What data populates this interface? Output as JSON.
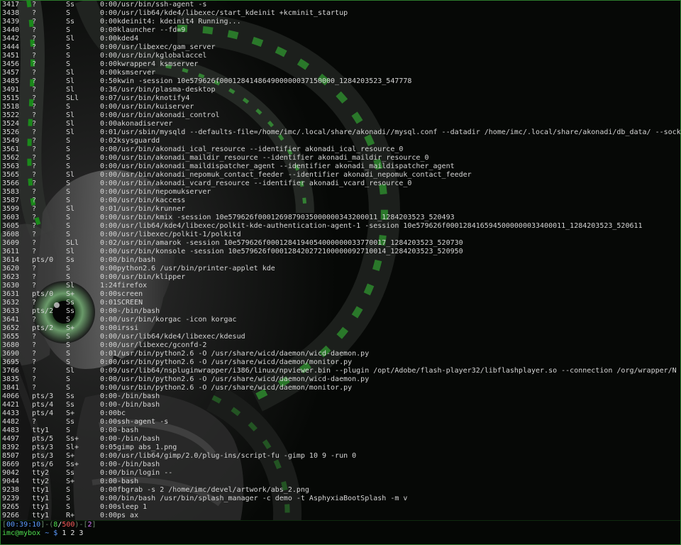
{
  "processes": [
    {
      "pid": "3417",
      "tty": "?",
      "stat": "Ss",
      "time": "0:00",
      "command": "/usr/bin/ssh-agent -s"
    },
    {
      "pid": "3438",
      "tty": "?",
      "stat": "S",
      "time": "0:00",
      "command": "/usr/lib64/kde4/libexec/start_kdeinit +kcminit_startup"
    },
    {
      "pid": "3439",
      "tty": "?",
      "stat": "Ss",
      "time": "0:00",
      "command": "kdeinit4: kdeinit4 Running..."
    },
    {
      "pid": "3440",
      "tty": "?",
      "stat": "S",
      "time": "0:00",
      "command": "klauncher --fd=9"
    },
    {
      "pid": "3442",
      "tty": "?",
      "stat": "Sl",
      "time": "0:00",
      "command": "kded4"
    },
    {
      "pid": "3444",
      "tty": "?",
      "stat": "S",
      "time": "0:00",
      "command": "/usr/libexec/gam_server"
    },
    {
      "pid": "3451",
      "tty": "?",
      "stat": "S",
      "time": "0:00",
      "command": "/usr/bin/kglobalaccel"
    },
    {
      "pid": "3456",
      "tty": "?",
      "stat": "S",
      "time": "0:00",
      "command": "kwrapper4 ksmserver"
    },
    {
      "pid": "3457",
      "tty": "?",
      "stat": "Sl",
      "time": "0:00",
      "command": "ksmserver"
    },
    {
      "pid": "3485",
      "tty": "?",
      "stat": "Sl",
      "time": "0:50",
      "command": "kwin -session 10e579626f000128414864900000037150000_1284203523_547778"
    },
    {
      "pid": "3491",
      "tty": "?",
      "stat": "Sl",
      "time": "0:36",
      "command": "/usr/bin/plasma-desktop"
    },
    {
      "pid": "3515",
      "tty": "?",
      "stat": "SLl",
      "time": "0:07",
      "command": "/usr/bin/knotify4"
    },
    {
      "pid": "3518",
      "tty": "?",
      "stat": "S",
      "time": "0:00",
      "command": "/usr/bin/kuiserver"
    },
    {
      "pid": "3522",
      "tty": "?",
      "stat": "Sl",
      "time": "0:00",
      "command": "/usr/bin/akonadi_control"
    },
    {
      "pid": "3524",
      "tty": "?",
      "stat": "Sl",
      "time": "0:00",
      "command": "akonadiserver"
    },
    {
      "pid": "3526",
      "tty": "?",
      "stat": "Sl",
      "time": "0:01",
      "command": "/usr/sbin/mysqld --defaults-file=/home/imc/.local/share/akonadi//mysql.conf --datadir /home/imc/.local/share/akonadi/db_data/ --sock"
    },
    {
      "pid": "3549",
      "tty": "?",
      "stat": "S",
      "time": "0:02",
      "command": "ksysguardd"
    },
    {
      "pid": "3561",
      "tty": "?",
      "stat": "S",
      "time": "0:00",
      "command": "/usr/bin/akonadi_ical_resource --identifier akonadi_ical_resource_0"
    },
    {
      "pid": "3562",
      "tty": "?",
      "stat": "S",
      "time": "0:00",
      "command": "/usr/bin/akonadi_maildir_resource --identifier akonadi_maildir_resource_0"
    },
    {
      "pid": "3563",
      "tty": "?",
      "stat": "S",
      "time": "0:00",
      "command": "/usr/bin/akonadi_maildispatcher_agent --identifier akonadi_maildispatcher_agent"
    },
    {
      "pid": "3565",
      "tty": "?",
      "stat": "Sl",
      "time": "0:00",
      "command": "/usr/bin/akonadi_nepomuk_contact_feeder --identifier akonadi_nepomuk_contact_feeder"
    },
    {
      "pid": "3566",
      "tty": "?",
      "stat": "S",
      "time": "0:00",
      "command": "/usr/bin/akonadi_vcard_resource --identifier akonadi_vcard_resource_0"
    },
    {
      "pid": "3583",
      "tty": "?",
      "stat": "S",
      "time": "0:00",
      "command": "/usr/bin/nepomukserver"
    },
    {
      "pid": "3587",
      "tty": "?",
      "stat": "S",
      "time": "0:00",
      "command": "/usr/bin/kaccess"
    },
    {
      "pid": "3599",
      "tty": "?",
      "stat": "Sl",
      "time": "0:01",
      "command": "/usr/bin/krunner"
    },
    {
      "pid": "3603",
      "tty": "?",
      "stat": "S",
      "time": "0:00",
      "command": "/usr/bin/kmix -session 10e579626f0001269879035000000343200011_1284203523_520493"
    },
    {
      "pid": "3605",
      "tty": "?",
      "stat": "S",
      "time": "0:00",
      "command": "/usr/lib64/kde4/libexec/polkit-kde-authentication-agent-1 -session 10e579626f0001284165945000000033400011_1284203523_520611"
    },
    {
      "pid": "3608",
      "tty": "?",
      "stat": "S",
      "time": "0:00",
      "command": "/usr/libexec/polkit-1/polkitd"
    },
    {
      "pid": "3609",
      "tty": "?",
      "stat": "SLl",
      "time": "0:02",
      "command": "/usr/bin/amarok -session 10e579626f0001284194054000000033770017_1284203523_520730"
    },
    {
      "pid": "3611",
      "tty": "?",
      "stat": "Sl",
      "time": "0:00",
      "command": "/usr/bin/konsole -session 10e579626f000128420272100000092710014_1284203523_520950"
    },
    {
      "pid": "3614",
      "tty": "pts/0",
      "stat": "Ss",
      "time": "0:00",
      "command": "/bin/bash"
    },
    {
      "pid": "3620",
      "tty": "?",
      "stat": "S",
      "time": "0:00",
      "command": "python2.6 /usr/bin/printer-applet kde"
    },
    {
      "pid": "3623",
      "tty": "?",
      "stat": "S",
      "time": "0:00",
      "command": "/usr/bin/klipper"
    },
    {
      "pid": "3630",
      "tty": "?",
      "stat": "Sl",
      "time": "1:24",
      "command": "firefox"
    },
    {
      "pid": "3631",
      "tty": "pts/0",
      "stat": "S+",
      "time": "0:00",
      "command": "screen"
    },
    {
      "pid": "3632",
      "tty": "?",
      "stat": "Ss",
      "time": "0:01",
      "command": "SCREEN"
    },
    {
      "pid": "3633",
      "tty": "pts/2",
      "stat": "Ss",
      "time": "0:00",
      "command": "-/bin/bash"
    },
    {
      "pid": "3641",
      "tty": "?",
      "stat": "S",
      "time": "0:00",
      "command": "/usr/bin/korgac -icon korgac"
    },
    {
      "pid": "3652",
      "tty": "pts/2",
      "stat": "S+",
      "time": "0:00",
      "command": "irssi"
    },
    {
      "pid": "3655",
      "tty": "?",
      "stat": "S",
      "time": "0:00",
      "command": "/usr/lib64/kde4/libexec/kdesud"
    },
    {
      "pid": "3680",
      "tty": "?",
      "stat": "S",
      "time": "0:00",
      "command": "/usr/libexec/gconfd-2"
    },
    {
      "pid": "3690",
      "tty": "?",
      "stat": "S",
      "time": "0:01",
      "command": "/usr/bin/python2.6 -O /usr/share/wicd/daemon/wicd-daemon.py"
    },
    {
      "pid": "3695",
      "tty": "?",
      "stat": "S",
      "time": "0:00",
      "command": "/usr/bin/python2.6 -O /usr/share/wicd/daemon/monitor.py"
    },
    {
      "pid": "3766",
      "tty": "?",
      "stat": "Sl",
      "time": "0:09",
      "command": "/usr/lib64/nspluginwrapper/i386/linux/npviewer.bin --plugin /opt/Adobe/flash-player32/libflashplayer.so --connection /org/wrapper/N"
    },
    {
      "pid": "3835",
      "tty": "?",
      "stat": "S",
      "time": "0:00",
      "command": "/usr/bin/python2.6 -O /usr/share/wicd/daemon/wicd-daemon.py"
    },
    {
      "pid": "3841",
      "tty": "?",
      "stat": "S",
      "time": "0:00",
      "command": "/usr/bin/python2.6 -O /usr/share/wicd/daemon/monitor.py"
    },
    {
      "pid": "4066",
      "tty": "pts/3",
      "stat": "Ss",
      "time": "0:00",
      "command": "-/bin/bash"
    },
    {
      "pid": "4421",
      "tty": "pts/4",
      "stat": "Ss",
      "time": "0:00",
      "command": "-/bin/bash"
    },
    {
      "pid": "4433",
      "tty": "pts/4",
      "stat": "S+",
      "time": "0:00",
      "command": "bc"
    },
    {
      "pid": "4482",
      "tty": "?",
      "stat": "Ss",
      "time": "0:00",
      "command": "ssh-agent -s"
    },
    {
      "pid": "4483",
      "tty": "tty1",
      "stat": "S",
      "time": "0:00",
      "command": "-bash"
    },
    {
      "pid": "4497",
      "tty": "pts/5",
      "stat": "Ss+",
      "time": "0:00",
      "command": "-/bin/bash"
    },
    {
      "pid": "8392",
      "tty": "pts/3",
      "stat": "Sl+",
      "time": "0:05",
      "command": "gimp abs_1.png"
    },
    {
      "pid": "8507",
      "tty": "pts/3",
      "stat": "S+",
      "time": "0:00",
      "command": "/usr/lib64/gimp/2.0/plug-ins/script-fu -gimp 10 9 -run 0"
    },
    {
      "pid": "8669",
      "tty": "pts/6",
      "stat": "Ss+",
      "time": "0:00",
      "command": "-/bin/bash"
    },
    {
      "pid": "9042",
      "tty": "tty2",
      "stat": "Ss",
      "time": "0:00",
      "command": "/bin/login --"
    },
    {
      "pid": "9044",
      "tty": "tty2",
      "stat": "S+",
      "time": "0:00",
      "command": "-bash"
    },
    {
      "pid": "9238",
      "tty": "tty1",
      "stat": "S",
      "time": "0:00",
      "command": "fbgrab -s 2 /home/imc/devel/artwork/abs_2.png"
    },
    {
      "pid": "9239",
      "tty": "tty1",
      "stat": "S",
      "time": "0:00",
      "command": "/bin/bash /usr/bin/splash_manager -c demo -t AsphyxiaBootSplash -m v"
    },
    {
      "pid": "9265",
      "tty": "tty1",
      "stat": "S",
      "time": "0:00",
      "command": "sleep 1"
    },
    {
      "pid": "9266",
      "tty": "tty1",
      "stat": "R+",
      "time": "0:00",
      "command": "ps ax"
    }
  ],
  "status": {
    "bracket_open": "[",
    "time": "00:39:10",
    "bracket_close": "]",
    "sep1": "-",
    "mem_open": "(",
    "mem_used": "8",
    "mem_slash": "/",
    "mem_total": "500",
    "mem_close": ")",
    "sep2": "-",
    "load_open": "[",
    "load_value": "2",
    "load_close": "]"
  },
  "prompt": {
    "user_host": "imc@mybox",
    "cwd": "~",
    "symbol": "$",
    "windows": [
      "1",
      "2",
      "3"
    ]
  },
  "colors": {
    "background": "#060806",
    "text": "#d6d6d6",
    "accent_green": "#4fe04f",
    "accent_blue": "#5b9bff",
    "border": "#2c7a2c"
  }
}
